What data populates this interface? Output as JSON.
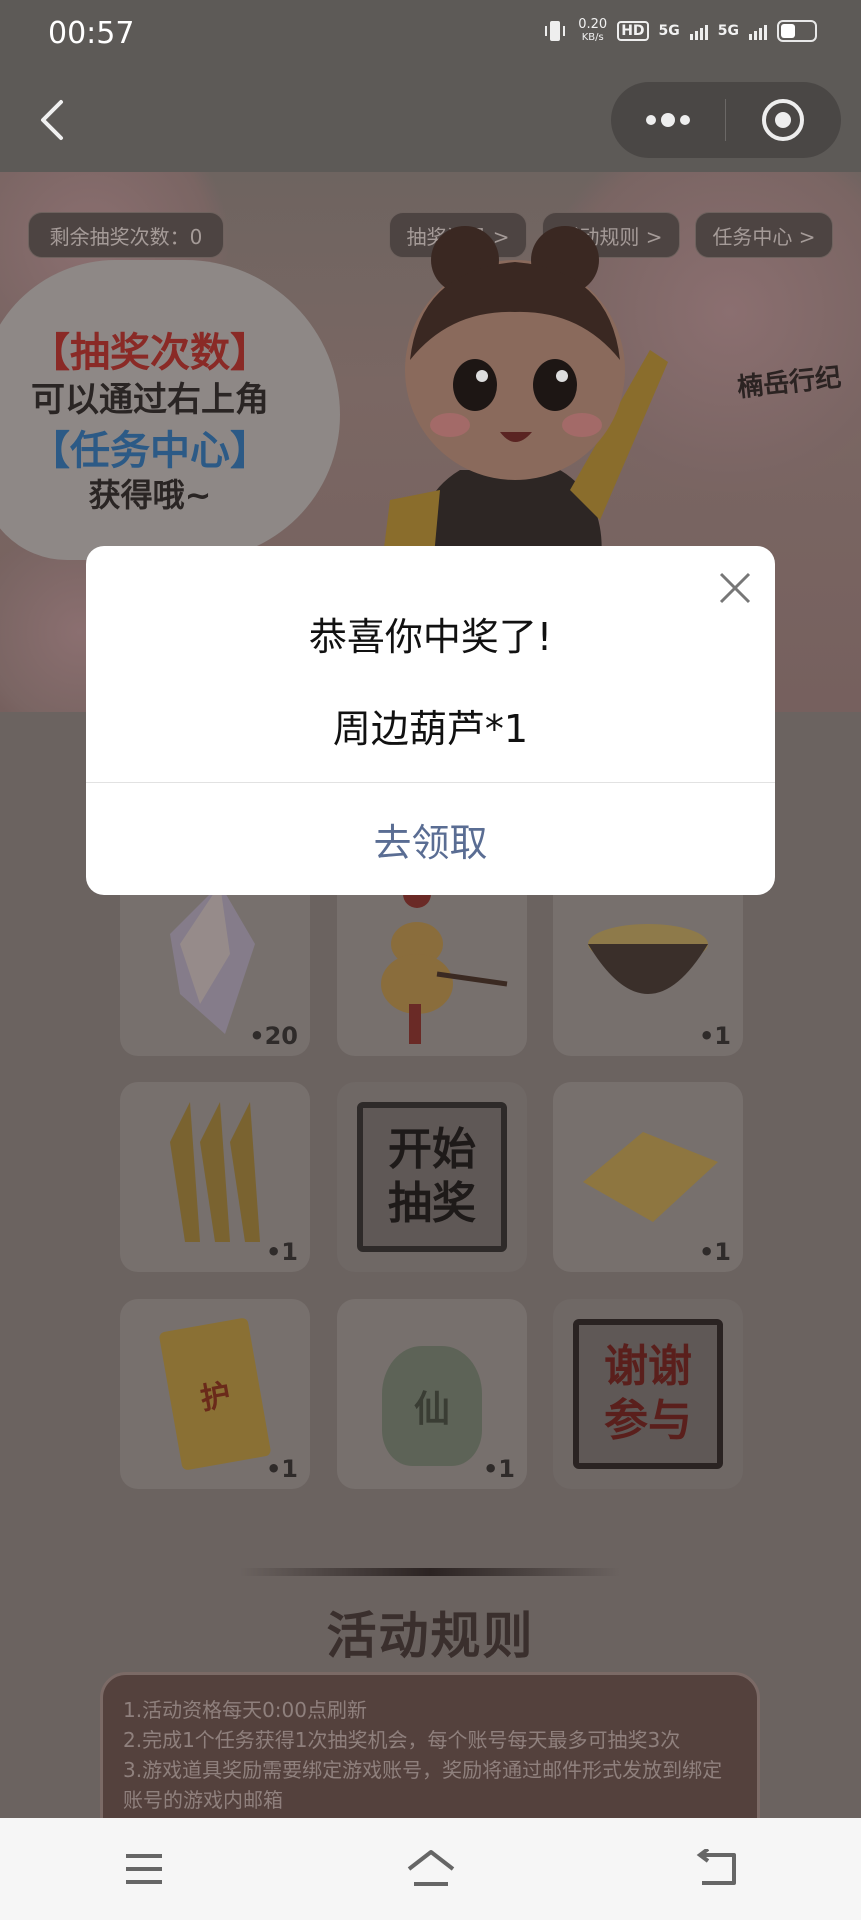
{
  "status": {
    "time": "00:57",
    "speed_value": "0.20",
    "speed_unit": "KB/s",
    "hd_label": "HD",
    "net1": "5G",
    "net2": "5G"
  },
  "topbar": {
    "back_icon": "chevron-left-icon",
    "more_icon": "more-dots-icon",
    "close_icon": "target-circle-icon"
  },
  "banner": {
    "remaining_label": "剩余抽奖次数：0",
    "links": [
      "抽奖记录 >",
      "活动规则 >",
      "任务中心 >"
    ],
    "bubble_lines": [
      "【抽奖次数】",
      "可以通过右上角",
      "【任务中心】",
      "获得哦~"
    ],
    "logo_text": "楠岳行纪"
  },
  "prizes": {
    "row1": [
      {
        "qty": "•20",
        "icon": "crystal-icon"
      },
      {
        "qty": "",
        "icon": "gourd-charm-icon"
      },
      {
        "qty": "•1",
        "icon": "bowl-icon"
      }
    ],
    "row2": [
      {
        "qty": "•1",
        "icon": "talisman-swords-icon"
      },
      {
        "start_line1": "开始",
        "start_line2": "抽奖"
      },
      {
        "qty": "•1",
        "icon": "gold-paper-icon"
      }
    ],
    "row3": [
      {
        "qty": "•1",
        "icon": "amulet-icon",
        "amulet_char": "护"
      },
      {
        "qty": "•1",
        "icon": "jade-pendant-icon",
        "pendant_char": "仙"
      },
      {
        "thanks_line1": "谢谢",
        "thanks_line2": "参与"
      }
    ]
  },
  "rules": {
    "title": "活动规则",
    "lines": [
      "1.活动资格每天0:00点刷新",
      "2.完成1个任务获得1次抽奖机会，每个账号每天最多可抽奖3次",
      "3.游戏道具奖励需要绑定游戏账号，奖励将通过邮件形式发放到绑定账号的游戏内邮箱"
    ]
  },
  "modal": {
    "title": "恭喜你中奖了!",
    "prize": "周边葫芦*1",
    "action": "去领取",
    "close_icon": "close-icon"
  },
  "bottom_nav": {
    "menu_icon": "menu-icon",
    "home_icon": "home-icon",
    "back_icon": "return-icon"
  },
  "colors": {
    "overlay_bg": "#6b6360",
    "modal_action": "#5a6d93",
    "cloud_red": "#8a2a26",
    "cloud_blue": "#2c5a86"
  }
}
